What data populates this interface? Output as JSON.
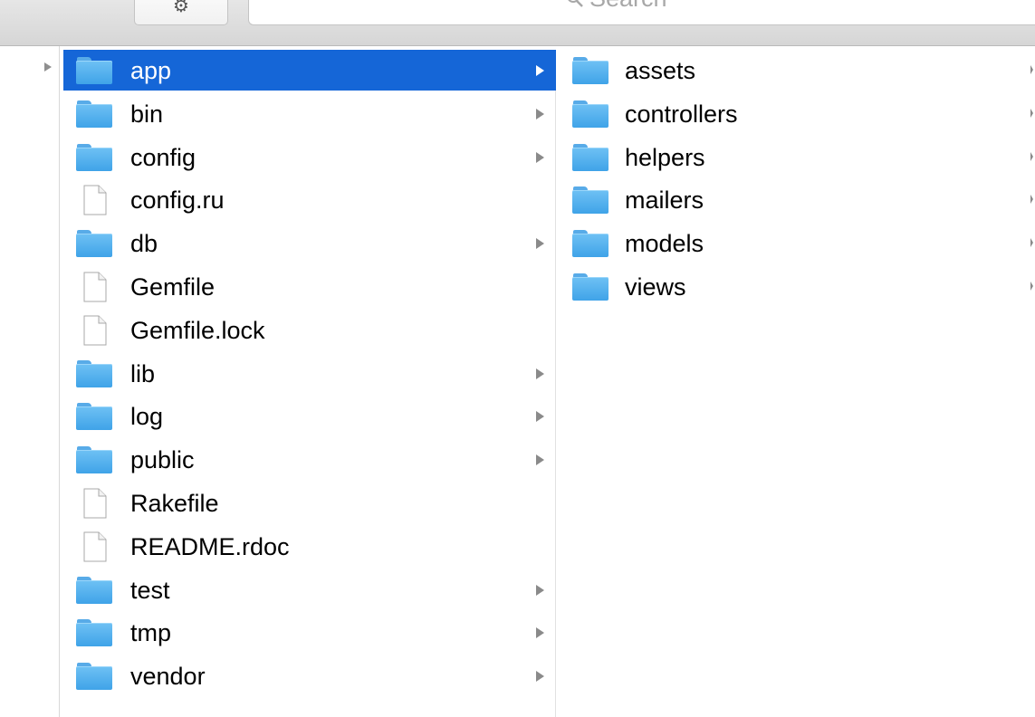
{
  "toolbar": {
    "action_icon": "gear-icon",
    "search_placeholder": "Search",
    "search_icon": "magnifier-icon"
  },
  "colors": {
    "selection": "#1566d7",
    "folder": "#4aaeed",
    "chevron": "#8a8a8a"
  },
  "column1": {
    "items": [
      {
        "name": "app",
        "kind": "folder",
        "has_children": true,
        "selected": true
      },
      {
        "name": "bin",
        "kind": "folder",
        "has_children": true
      },
      {
        "name": "config",
        "kind": "folder",
        "has_children": true
      },
      {
        "name": "config.ru",
        "kind": "file",
        "has_children": false
      },
      {
        "name": "db",
        "kind": "folder",
        "has_children": true
      },
      {
        "name": "Gemfile",
        "kind": "file",
        "has_children": false
      },
      {
        "name": "Gemfile.lock",
        "kind": "file",
        "has_children": false
      },
      {
        "name": "lib",
        "kind": "folder",
        "has_children": true
      },
      {
        "name": "log",
        "kind": "folder",
        "has_children": true
      },
      {
        "name": "public",
        "kind": "folder",
        "has_children": true
      },
      {
        "name": "Rakefile",
        "kind": "file",
        "has_children": false
      },
      {
        "name": "README.rdoc",
        "kind": "file",
        "has_children": false
      },
      {
        "name": "test",
        "kind": "folder",
        "has_children": true
      },
      {
        "name": "tmp",
        "kind": "folder",
        "has_children": true
      },
      {
        "name": "vendor",
        "kind": "folder",
        "has_children": true
      }
    ]
  },
  "column2": {
    "items": [
      {
        "name": "assets",
        "kind": "folder",
        "has_children": true
      },
      {
        "name": "controllers",
        "kind": "folder",
        "has_children": true
      },
      {
        "name": "helpers",
        "kind": "folder",
        "has_children": true
      },
      {
        "name": "mailers",
        "kind": "folder",
        "has_children": true
      },
      {
        "name": "models",
        "kind": "folder",
        "has_children": true
      },
      {
        "name": "views",
        "kind": "folder",
        "has_children": true
      }
    ]
  }
}
